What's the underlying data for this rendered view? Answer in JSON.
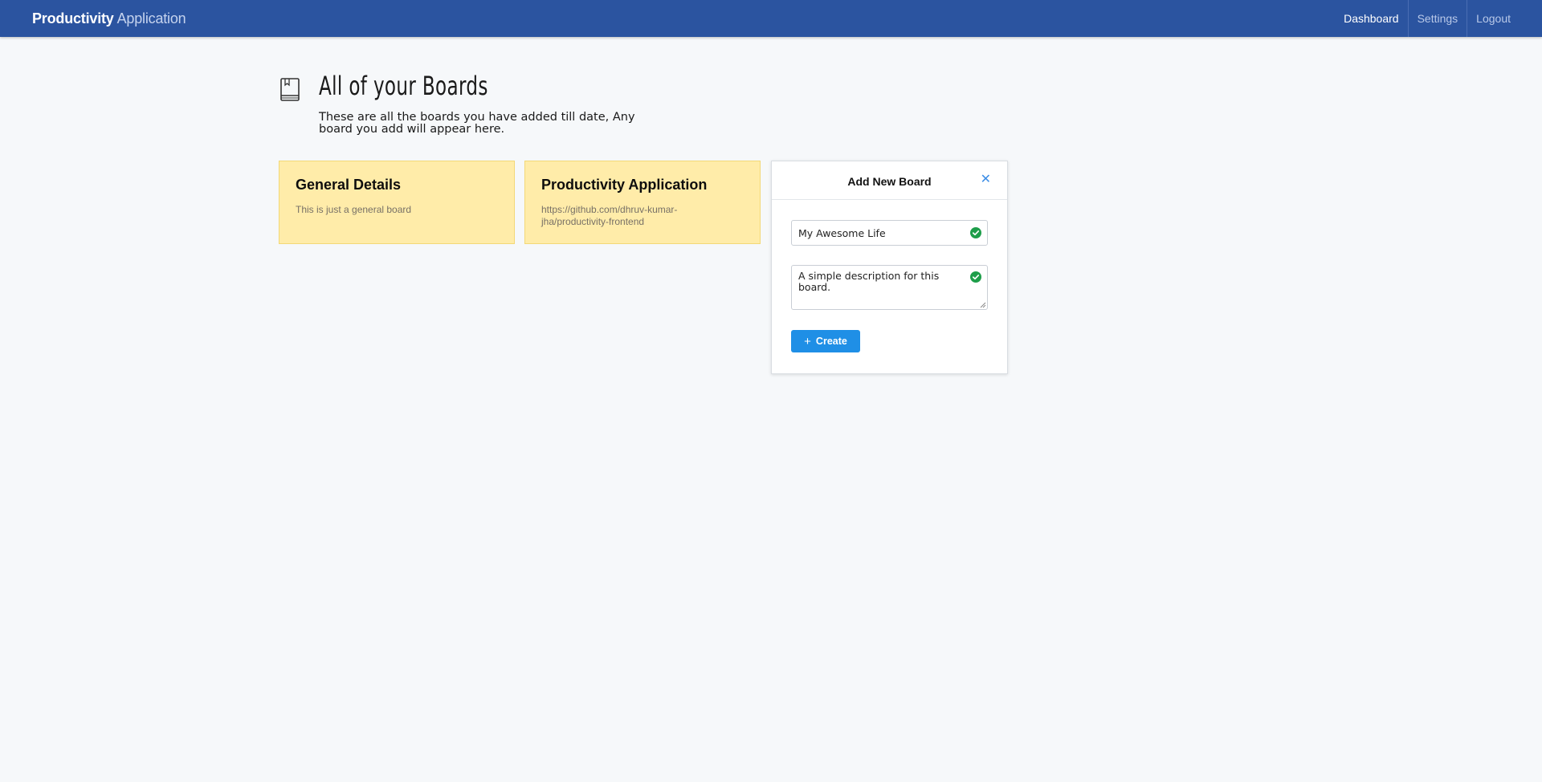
{
  "navbar": {
    "brand_strong": "Productivity",
    "brand_light": "Application",
    "links": [
      {
        "label": "Dashboard",
        "active": true
      },
      {
        "label": "Settings",
        "active": false
      },
      {
        "label": "Logout",
        "active": false
      }
    ]
  },
  "header": {
    "icon": "book-icon",
    "title": "All of your Boards",
    "subtitle": "These are all the boards you have added till date, Any board you add will appear here."
  },
  "boards": [
    {
      "title": "General Details",
      "description": "This is just a general board"
    },
    {
      "title": "Productivity Application",
      "description": "https://github.com/dhruv-kumar-jha/productivity-frontend"
    }
  ],
  "add_board": {
    "title": "Add New Board",
    "close_icon": "close-icon",
    "name_value": "My Awesome Life",
    "description_value": "A simple description for this board.",
    "valid_icon": "check-circle-icon",
    "create_label": "Create",
    "create_icon": "plus-icon"
  },
  "colors": {
    "navbar": "#2b54a0",
    "card": "#ffeca9",
    "primary_button": "#1f8fe6",
    "valid_check": "#1e9e4a",
    "background": "#f6f8fa"
  }
}
